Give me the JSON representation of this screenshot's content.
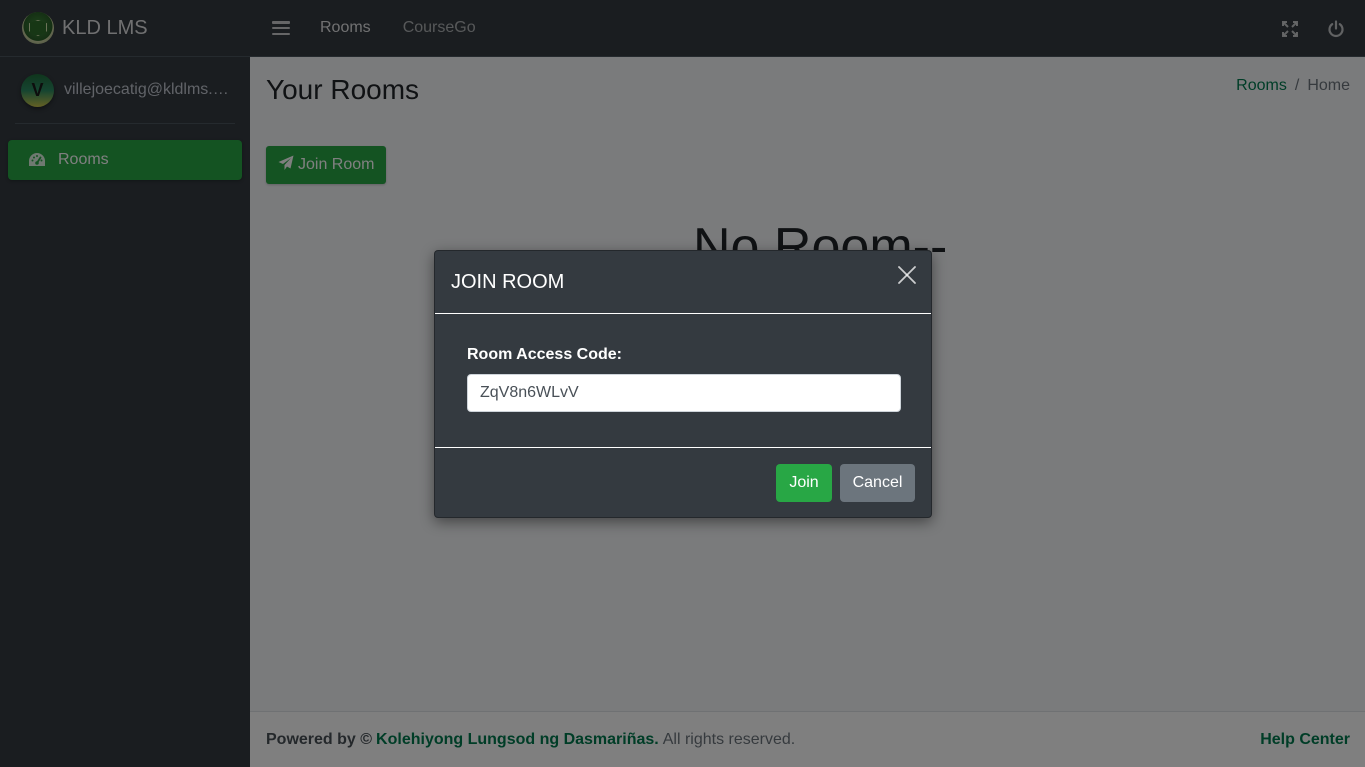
{
  "brand": {
    "name": "KLD LMS"
  },
  "user": {
    "initial": "V",
    "email": "villejoecatig@kldlms.c..."
  },
  "sidebar": {
    "items": [
      {
        "label": "Rooms",
        "icon": "dashboard-gauge-icon",
        "active": true
      }
    ]
  },
  "topnav": {
    "links": [
      "Rooms",
      "CourseGo"
    ]
  },
  "page": {
    "title": "Your Rooms",
    "breadcrumb": {
      "link": "Rooms",
      "separator": "/",
      "current": "Home"
    },
    "join_button": "Join Room",
    "empty_text": "No Room--"
  },
  "footer": {
    "powered_prefix": "Powered by ©",
    "org": "Kolehiyong Lungsod ng Dasmariñas.",
    "rights": "All rights reserved.",
    "help": "Help Center"
  },
  "modal": {
    "title": "JOIN ROOM",
    "field_label": "Room Access Code:",
    "field_value": "ZqV8n6WLvV",
    "join_label": "Join",
    "cancel_label": "Cancel"
  },
  "colors": {
    "primary_green": "#28a745",
    "link_green": "#007b4f",
    "dark_bg": "#343a40",
    "secondary": "#6c757d"
  }
}
